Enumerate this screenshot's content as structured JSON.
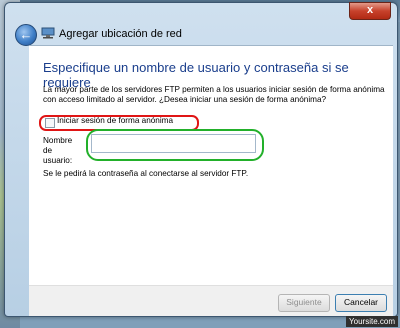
{
  "window": {
    "title": "Agregar ubicación de red",
    "close_label": "x"
  },
  "content": {
    "heading": "Especifique un nombre de usuario y contraseña si se requiere",
    "description": "La mayor parte de los servidores FTP permiten a los usuarios iniciar sesión de forma anónima con acceso limitado al servidor. ¿Desea iniciar una sesión de forma anónima?",
    "anon_checkbox_label": "Iniciar sesión de forma anónima",
    "anon_checked": false,
    "username_label": "Nombre de usuario:",
    "username_value": "",
    "password_note": "Se le pedirá la contraseña al conectarse al servidor FTP."
  },
  "footer": {
    "next_label": "Siguiente",
    "cancel_label": "Cancelar"
  },
  "watermark": "Yoursite.com",
  "colors": {
    "heading": "#1a3e8c",
    "highlight_red": "#e01515",
    "highlight_green": "#22b02a"
  },
  "icons": [
    "back-arrow-icon",
    "network-location-icon",
    "close-icon"
  ]
}
